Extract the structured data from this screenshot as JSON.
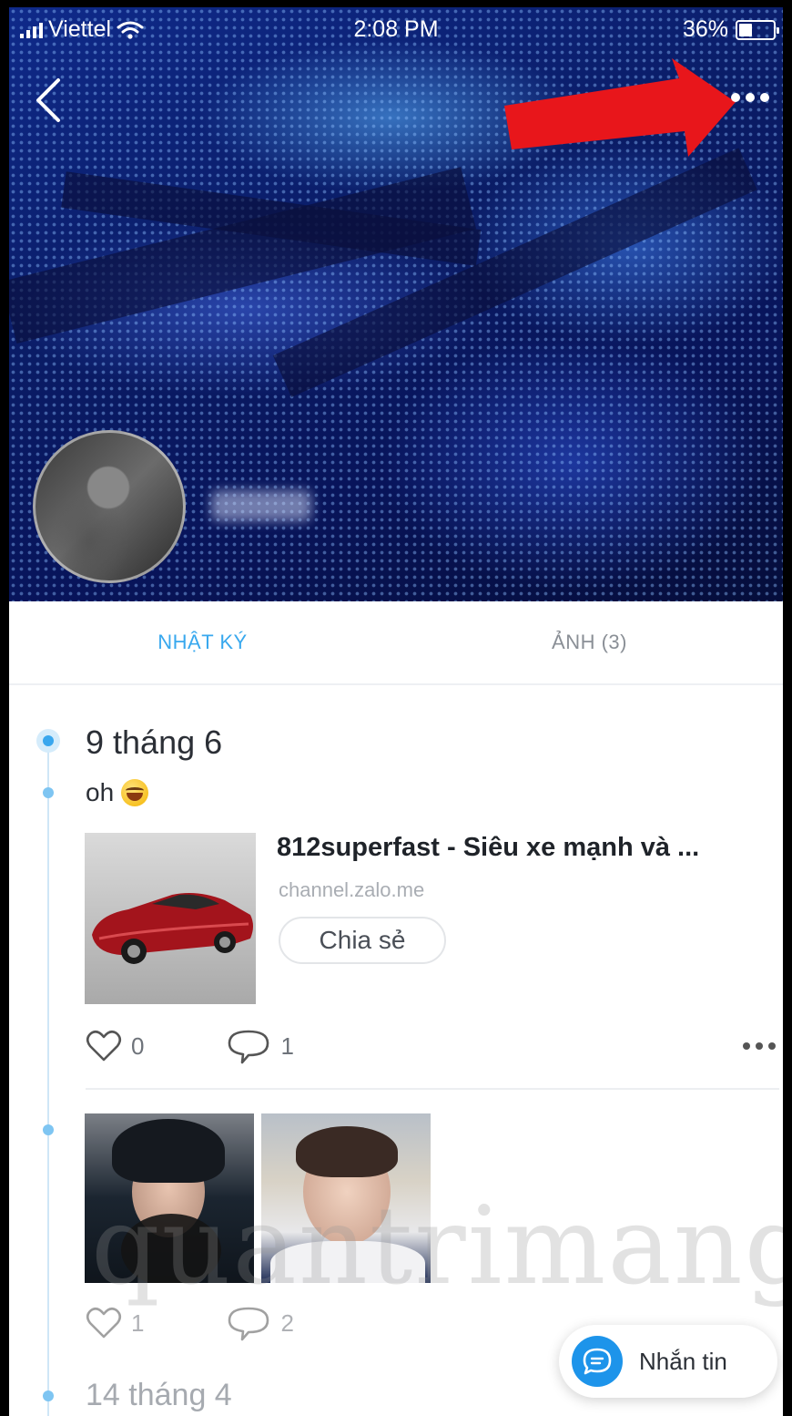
{
  "status_bar": {
    "carrier": "Viettel",
    "time": "2:08 PM",
    "battery": "36%"
  },
  "tabs": [
    {
      "label": "NHẬT KÝ",
      "active": true
    },
    {
      "label": "ẢNH (3)",
      "active": false
    }
  ],
  "posts": [
    {
      "date": "9 tháng 6",
      "text": "oh",
      "link": {
        "title": "812superfast - Siêu xe mạnh và ...",
        "domain": "channel.zalo.me",
        "share_label": "Chia sẻ"
      },
      "likes": "0",
      "comments": "1"
    },
    {
      "likes": "1",
      "comments": "2"
    }
  ],
  "next_date": "14 tháng 4",
  "message_button": "Nhắn tin",
  "watermark": "quantrimang",
  "colors": {
    "accent": "#38a8ee",
    "message_button": "#1d94ea",
    "annotation_arrow": "#e8161b"
  },
  "icons": [
    "back-icon",
    "more-icon",
    "heart-icon",
    "comment-icon",
    "message-icon",
    "wifi-icon",
    "battery-icon"
  ]
}
